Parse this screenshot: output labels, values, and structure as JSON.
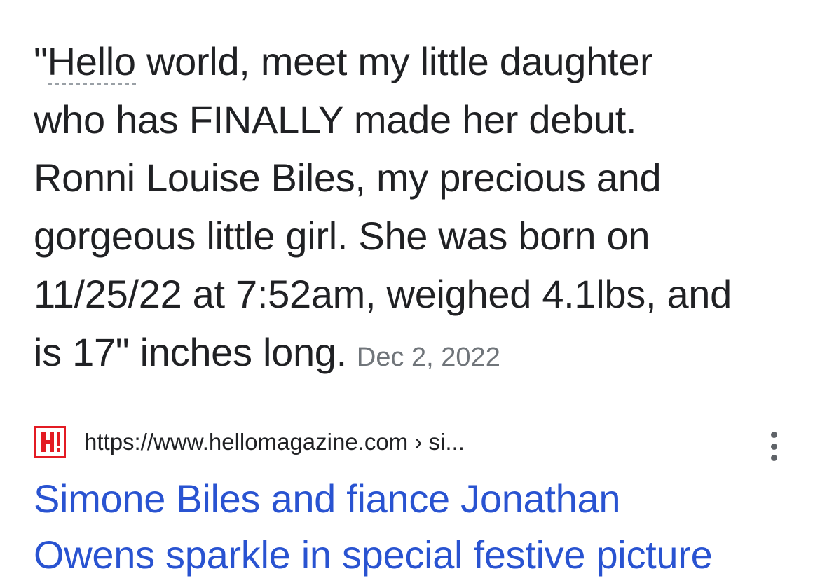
{
  "snippet": {
    "quote_open": "\"",
    "hello": "Hello",
    "line1_rest": " world, meet my little daughter",
    "line2": "who has FINALLY made her debut.",
    "line3": "Ronni Louise Biles, my precious and",
    "line4": "gorgeous little girl. She was born on",
    "line5": "11/25/22 at 7:52am, weighed 4.1lbs, and",
    "line6": "is 17\" inches long.",
    "date": "Dec 2, 2022"
  },
  "result": {
    "favicon_icon": "hello-magazine-logo",
    "favicon_color": "#e31b23",
    "url": "https://www.hellomagazine.com › si...",
    "more_icon": "more-vert-icon",
    "title_line1": "Simone Biles and fiance Jonathan",
    "title_line2": "Owens sparkle in special festive picture",
    "title_color": "#2953d1"
  }
}
